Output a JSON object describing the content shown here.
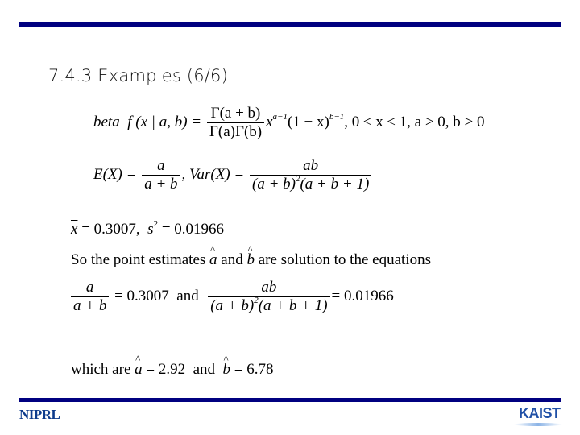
{
  "slide": {
    "title": "7.4.3 Examples (6/6)",
    "footer_left": "NIPRL",
    "footer_right": "KAIST",
    "accent_color": "#000080"
  },
  "equations": {
    "beta_label": "beta",
    "beta_lhs": "f (x | a, b) =",
    "beta_num": "Γ(a + b)",
    "beta_den": "Γ(a)Γ(b)",
    "beta_x": "x",
    "beta_exp1": "a−1",
    "beta_mid": "(1 − x)",
    "beta_exp2": "b−1",
    "beta_cond": ", 0 ≤ x ≤ 1, a > 0, b > 0",
    "ex_lhs": "E(X) =",
    "ex_num": "a",
    "ex_den": "a + b",
    "var_lhs": ", Var(X) =",
    "var_num": "ab",
    "var_den_a": "(a + b)",
    "var_den_sq": "2",
    "var_den_b": "(a + b + 1)"
  },
  "stats": {
    "xbar_sym": "x",
    "xbar_val": "= 0.3007,",
    "s_sym": "s",
    "s_exp": "2",
    "s_val": "= 0.01966"
  },
  "text": {
    "so_prefix": "So the point estimates",
    "a_hat": "a",
    "and1": "and",
    "b_hat": "b",
    "so_suffix": "are solution to the equations",
    "eq1_num": "a",
    "eq1_den": "a + b",
    "eq1_val": "= 0.3007",
    "and2": "and",
    "eq2_num": "ab",
    "eq2_den_a": "(a + b)",
    "eq2_den_sq": "2",
    "eq2_den_b": "(a + b + 1)",
    "eq2_val": "= 0.01966",
    "which_prefix": "which are",
    "res_a_sym": "a",
    "res_a_val": "= 2.92",
    "and3": "and",
    "res_b_sym": "b",
    "res_b_val": "= 6.78"
  }
}
